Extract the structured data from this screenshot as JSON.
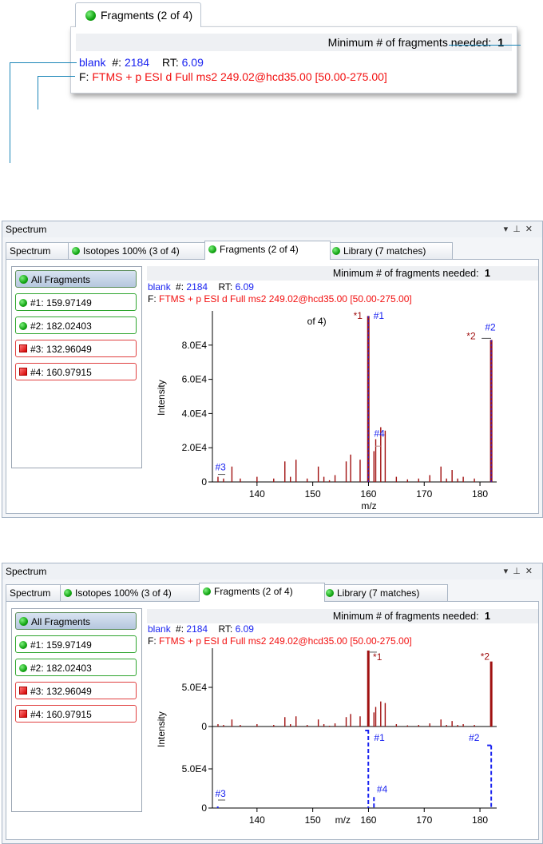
{
  "callout": {
    "tab_label": "Fragments (2 of 4)",
    "min_frag_label": "Minimum # of fragments needed:",
    "min_frag_value": "1",
    "scan_name": "blank",
    "scan_num_label": "#:",
    "scan_num": "2184",
    "rt_label": "RT:",
    "rt_value": "6.09",
    "filter_label": "F:",
    "filter_text": "FTMS + p ESI d Full ms2 249.02@hcd35.00 [50.00-275.00]"
  },
  "panel1": {
    "title": "Spectrum",
    "tabs": [
      "Spectrum",
      "Isotopes 100% (3 of 4)",
      "Fragments (2 of 4)",
      "Library (7 matches)"
    ],
    "fragments": [
      "All Fragments",
      "#1: 159.97149",
      "#2: 182.02403",
      "#3: 132.96049",
      "#4: 160.97915"
    ],
    "min_frag_label": "Minimum # of fragments needed:",
    "min_frag_value": "1",
    "scan_name": "blank",
    "scan_num_label": "#:",
    "scan_num": "2184",
    "rt_label": "RT:",
    "rt_value": "6.09",
    "filter_label": "F:",
    "filter_text": "FTMS + p ESI d Full ms2 249.02@hcd35.00 [50.00-275.00]",
    "overlay_text": "of 4)"
  },
  "panel2": {
    "title": "Spectrum",
    "tabs": [
      "Spectrum",
      "Isotopes 100% (3 of 4)",
      "Fragments (2 of 4)",
      "Library (7 matches)"
    ],
    "fragments": [
      "All Fragments",
      "#1: 159.97149",
      "#2: 182.02403",
      "#3: 132.96049",
      "#4: 160.97915"
    ],
    "min_frag_label": "Minimum # of fragments needed:",
    "min_frag_value": "1",
    "scan_name": "blank",
    "scan_num_label": "#:",
    "scan_num": "2184",
    "rt_label": "RT:",
    "rt_value": "6.09",
    "filter_label": "F:",
    "filter_text": "FTMS + p ESI d Full ms2 249.02@hcd35.00 [50.00-275.00]"
  },
  "colors": {
    "match_green": "#12a412",
    "miss_red": "#d40000",
    "text_blue": "#1a23f0",
    "text_red": "#f21010",
    "peak": "#a01010",
    "callout_line": "#1b86b8"
  },
  "chart_data": [
    {
      "type": "bar",
      "xlabel": "m/z",
      "ylabel": "Intensity",
      "xlim": [
        132,
        183
      ],
      "ylim": [
        0,
        100000
      ],
      "xticks": [
        "140",
        "150",
        "160",
        "170",
        "180"
      ],
      "yticks": [
        "0",
        "2.0E4",
        "4.0E4",
        "6.0E4",
        "8.0E4"
      ],
      "peaks": {
        "x": [
          133,
          134,
          135.5,
          137,
          140,
          143,
          145,
          146,
          147,
          149,
          151,
          152,
          153,
          154,
          156,
          156.8,
          158.5,
          159.97,
          160.98,
          161.3,
          162.2,
          163,
          165,
          167,
          169,
          171,
          173,
          174,
          175,
          176,
          177,
          179,
          182.02
        ],
        "y": [
          3000,
          2000,
          9000,
          2000,
          3000,
          2000,
          12000,
          3000,
          13000,
          2000,
          9000,
          3000,
          1000,
          4000,
          12000,
          16000,
          13000,
          97000,
          18000,
          25000,
          32000,
          30000,
          3000,
          1500,
          2000,
          4000,
          9000,
          2000,
          7000,
          2000,
          3000,
          2000,
          83000
        ]
      },
      "annotations": [
        "*1",
        "#1",
        "*2",
        "#2",
        "#3",
        "#4"
      ]
    },
    {
      "type": "bar",
      "xlabel": "m/z",
      "ylabel": "Intensity",
      "xlim": [
        132,
        183
      ],
      "ylim": [
        0,
        100000
      ],
      "xticks": [
        "140",
        "150",
        "160",
        "170",
        "180"
      ],
      "yticks": [
        "0",
        "5.0E4"
      ],
      "series": [
        {
          "name": "*",
          "x": [
            133,
            134,
            135.5,
            137,
            140,
            143,
            145,
            146,
            147,
            149,
            151,
            152,
            153,
            154,
            156,
            156.8,
            158.5,
            159.97,
            160.98,
            161.3,
            162.2,
            163,
            165,
            167,
            169,
            171,
            173,
            174,
            175,
            176,
            177,
            179,
            182.02
          ],
          "y": [
            3000,
            2000,
            9000,
            2000,
            3000,
            2000,
            12000,
            3000,
            13000,
            2000,
            9000,
            3000,
            1000,
            4000,
            12000,
            16000,
            13000,
            97000,
            18000,
            25000,
            32000,
            30000,
            3000,
            1500,
            2000,
            4000,
            9000,
            2000,
            7000,
            2000,
            3000,
            2000,
            83000
          ]
        },
        {
          "name": "#",
          "x": [
            132.96,
            159.97,
            160.98,
            182.02
          ],
          "y": [
            2000,
            100000,
            14000,
            80000
          ]
        }
      ],
      "annotations": [
        "*1",
        "*2",
        "#1",
        "#2",
        "#3",
        "#4"
      ]
    }
  ]
}
